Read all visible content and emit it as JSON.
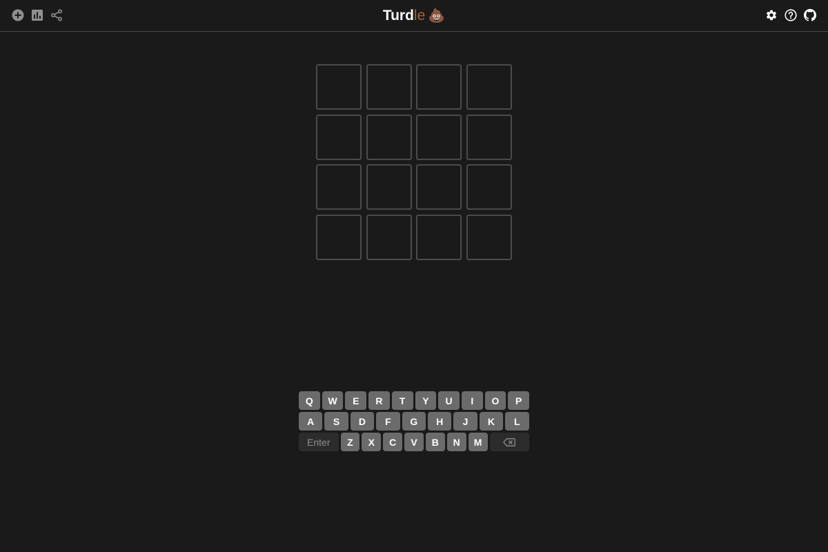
{
  "header": {
    "title_main": "Turd",
    "title_accent": "le",
    "title_emoji": "💩",
    "left_icons": [
      "plus-circle-icon",
      "bar-chart-icon",
      "share-icon"
    ],
    "right_icons": [
      "gear-icon",
      "help-circle-icon",
      "github-icon"
    ],
    "icon_color_left": "#8f8f8f",
    "icon_color_right": "#ffffff"
  },
  "board": {
    "rows": 4,
    "cols": 4,
    "cells": [
      [
        "",
        "",
        "",
        ""
      ],
      [
        "",
        "",
        "",
        ""
      ],
      [
        "",
        "",
        "",
        ""
      ],
      [
        "",
        "",
        "",
        ""
      ]
    ],
    "empty_border_color": "#4b4b4b"
  },
  "keyboard": {
    "row1": [
      "Q",
      "W",
      "E",
      "R",
      "T",
      "Y",
      "U",
      "I",
      "O",
      "P"
    ],
    "row2": [
      "A",
      "S",
      "D",
      "F",
      "G",
      "H",
      "J",
      "K",
      "L"
    ],
    "row3": [
      "Z",
      "X",
      "C",
      "V",
      "B",
      "N",
      "M"
    ],
    "enter_label": "Enter",
    "backspace_icon": "backspace-icon",
    "key_color": "#6b6b6b",
    "special_key_color": "#2c2c2c"
  },
  "colors": {
    "background": "#1a1a1a",
    "title_accent": "#a0663a"
  }
}
